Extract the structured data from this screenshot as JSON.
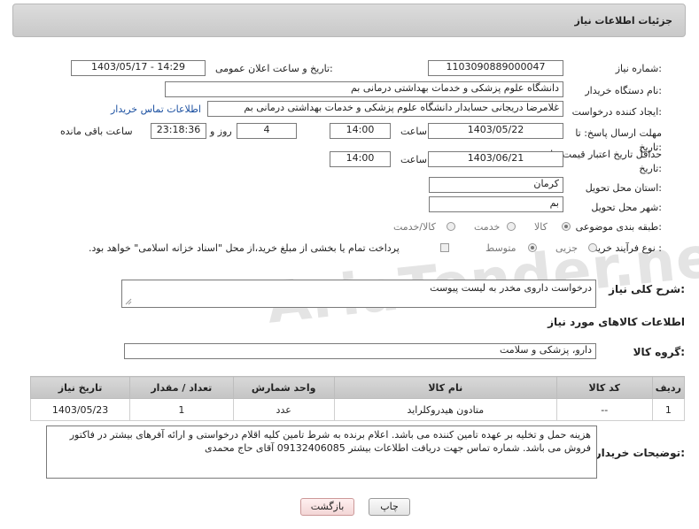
{
  "header": {
    "title": "جزئیات اطلاعات نیاز"
  },
  "watermark": "AriaTender.neT",
  "fields": {
    "need_number_label": "شماره نیاز:",
    "need_number": "1103090889000047",
    "announce_label": "تاریخ و ساعت اعلان عمومی:",
    "announce_value": "1403/05/17 - 14:29",
    "buyer_org_label": "نام دستگاه خریدار:",
    "buyer_org": "دانشگاه علوم پزشکی و خدمات بهداشتی  درمانی بم",
    "creator_label": "ایجاد کننده درخواست:",
    "creator": "غلامرضا دریجانی حسابدار دانشگاه علوم پزشکی و خدمات بهداشتی  درمانی بم",
    "contact_link": "اطلاعات تماس خریدار",
    "send_deadline_label": "مهلت ارسال پاسخ: تا تاریخ:",
    "send_date": "1403/05/22",
    "time_label": "ساعت",
    "send_time": "14:00",
    "days_value": "4",
    "days_label": "روز و",
    "remaining_time": "23:18:36",
    "remaining_label": "ساعت باقی مانده",
    "validity_label": "حداقل تاریخ اعتبار قیمت: تا تاریخ:",
    "validity_date": "1403/06/21",
    "validity_time": "14:00",
    "province_label": "استان محل تحویل:",
    "province": "کرمان",
    "city_label": "شهر محل تحویل:",
    "city": "بم",
    "category_label": "طبقه بندی موضوعی:",
    "category_options": [
      "کالا",
      "خدمت",
      "کالا/خدمت"
    ],
    "purchase_type_label": "نوع فرآیند خرید :",
    "purchase_options": [
      "جزیی",
      "متوسط"
    ],
    "payment_note": "پرداخت تمام یا بخشی از مبلغ خرید،از محل \"اسناد خزانه اسلامی\" خواهد بود.",
    "summary_label": "شرح کلی نیاز:",
    "summary": "درخواست داروی مخدر به لیست پیوست",
    "goods_info_title": "اطلاعات کالاهای مورد نیاز",
    "goods_group_label": "گروه کالا:",
    "goods_group": "دارو، پزشکی و سلامت",
    "buyer_notes_label": "توضیحات خریدار:",
    "buyer_notes": "هزینه حمل و تخلیه بر عهده تامین کننده می باشد. اعلام برنده به شرط تامین کلیه اقلام درخواستی و ارائه آفرهای بیشتر در فاکتور فروش می باشد.  شماره تماس جهت دریافت اطلاعات بیشتر 09132406085 آقای حاج محمدی"
  },
  "table": {
    "headers": [
      "ردیف",
      "کد کالا",
      "نام کالا",
      "واحد شمارش",
      "تعداد / مقدار",
      "تاریخ نیاز"
    ],
    "rows": [
      [
        "1",
        "--",
        "متادون هیدروکلراید",
        "عدد",
        "1",
        "1403/05/23"
      ]
    ]
  },
  "buttons": {
    "print": "چاپ",
    "back": "بازگشت"
  }
}
